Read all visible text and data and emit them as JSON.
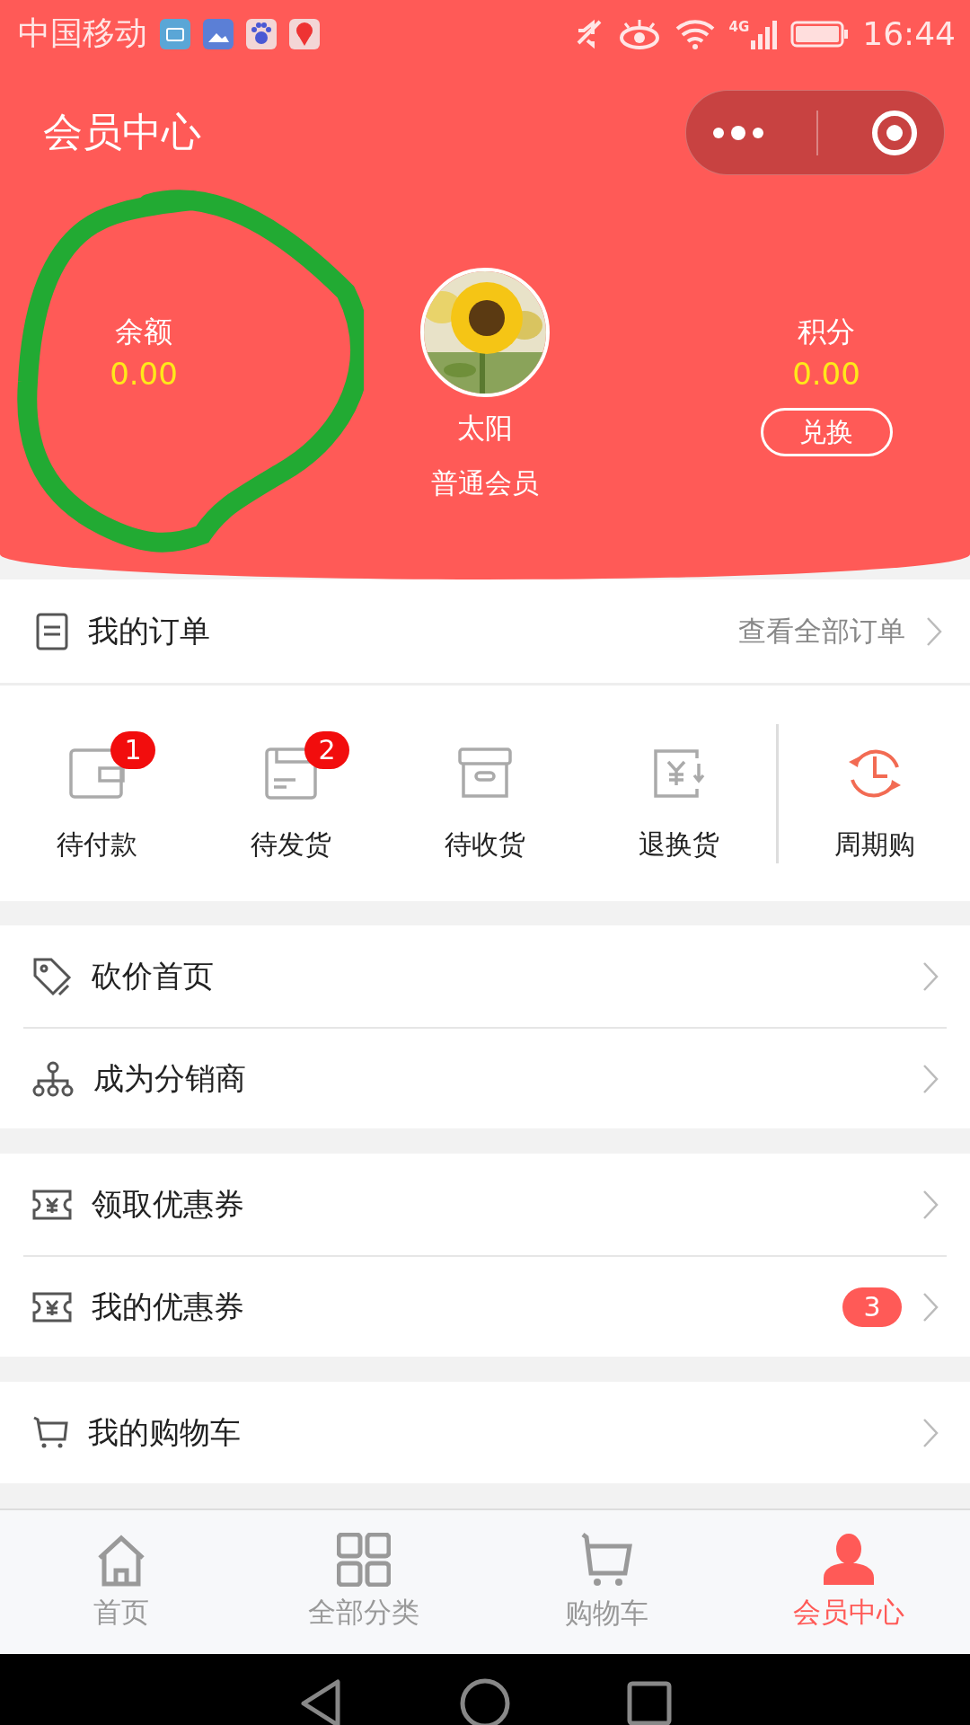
{
  "status_bar": {
    "carrier": "中国移动",
    "network": "4G",
    "time": "16:44"
  },
  "header": {
    "title": "会员中心"
  },
  "account": {
    "balance": {
      "label": "余额",
      "value": "0.00"
    },
    "profile": {
      "name": "太阳",
      "level": "普通会员"
    },
    "points": {
      "label": "积分",
      "value": "0.00",
      "button": "兑换"
    }
  },
  "orders": {
    "title": "我的订单",
    "link": "查看全部订单",
    "statuses": [
      {
        "label": "待付款",
        "badge": "1"
      },
      {
        "label": "待发货",
        "badge": "2"
      },
      {
        "label": "待收货"
      },
      {
        "label": "退换货"
      },
      {
        "label": "周期购"
      }
    ]
  },
  "menu_groups": [
    [
      {
        "label": "砍价首页"
      },
      {
        "label": "成为分销商"
      }
    ],
    [
      {
        "label": "领取优惠券"
      },
      {
        "label": "我的优惠券",
        "badge": "3"
      }
    ],
    [
      {
        "label": "我的购物车"
      }
    ]
  ],
  "tabs": [
    {
      "label": "首页",
      "selected": false
    },
    {
      "label": "全部分类",
      "selected": false
    },
    {
      "label": "购物车",
      "selected": false
    },
    {
      "label": "会员中心",
      "selected": true
    }
  ]
}
